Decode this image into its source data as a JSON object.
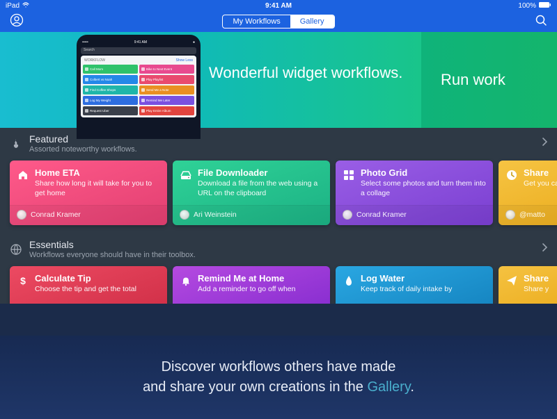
{
  "status": {
    "device": "iPad",
    "time": "9:41 AM",
    "battery": "100%"
  },
  "nav": {
    "tabs": {
      "my_workflows": "My Workflows",
      "gallery": "Gallery"
    }
  },
  "hero": {
    "widgets_title": "Wonderful widget workflows.",
    "run_title": "Run work",
    "phone": {
      "time": "9:41 AM",
      "search": "Search",
      "app": "WORKFLOW",
      "show_less": "Show Less",
      "tiles": [
        {
          "label": "Call Mom",
          "color": "#2fc26b"
        },
        {
          "label": "Bike to Next Event",
          "color": "#e84a8f"
        },
        {
          "label": "Colbert vs Noah",
          "color": "#2488e8"
        },
        {
          "label": "Play Playlist",
          "color": "#e94a6e"
        },
        {
          "label": "Find Coffee Shops",
          "color": "#1fb6a9"
        },
        {
          "label": "Send Me a Note",
          "color": "#e98f22"
        },
        {
          "label": "Log My Weight",
          "color": "#2d6de0"
        },
        {
          "label": "Remind Me Later",
          "color": "#7a50e0"
        },
        {
          "label": "Request Uber",
          "color": "#3a3f4a"
        },
        {
          "label": "Play Entire Album",
          "color": "#e2443e"
        }
      ]
    }
  },
  "featured": {
    "title": "Featured",
    "subtitle": "Assorted noteworthy workflows.",
    "cards": [
      {
        "title": "Home ETA",
        "desc": "Share how long it will take for you to get home",
        "author": "Conrad Kramer",
        "gradient": [
          "#ff5a8a",
          "#e23f71"
        ],
        "icon": "home"
      },
      {
        "title": "File Downloader",
        "desc": "Download a file from the web using a URL on the clipboard",
        "author": "Ari Weinstein",
        "gradient": [
          "#2fd297",
          "#1cb184"
        ],
        "icon": "hdd"
      },
      {
        "title": "Photo Grid",
        "desc": "Select some photos and turn them into a collage",
        "author": "Conrad Kramer",
        "gradient": [
          "#9a5ee6",
          "#7a3fd1"
        ],
        "icon": "grid"
      },
      {
        "title": "Share",
        "desc": "Get you calend",
        "author": "@matto",
        "gradient": [
          "#f6c443",
          "#e8a614"
        ],
        "icon": "clock"
      }
    ]
  },
  "essentials": {
    "title": "Essentials",
    "subtitle": "Workflows everyone should have in their toolbox.",
    "cards": [
      {
        "title": "Calculate Tip",
        "desc": "Choose the tip and get the total",
        "gradient": [
          "#ec4a62",
          "#d23149"
        ],
        "icon": "dollar"
      },
      {
        "title": "Remind Me at Home",
        "desc": "Add a reminder to go off when",
        "gradient": [
          "#b54ae0",
          "#8a2fd1"
        ],
        "icon": "bell"
      },
      {
        "title": "Log Water",
        "desc": "Keep track of daily intake by",
        "gradient": [
          "#2aa7e2",
          "#1686c2"
        ],
        "icon": "drop"
      },
      {
        "title": "Share",
        "desc": "Share y",
        "gradient": [
          "#f5c241",
          "#e8a614"
        ],
        "icon": "send"
      }
    ]
  },
  "promo": {
    "line1": "Discover workflows others have made",
    "line2_a": "and share your own creations in the ",
    "line2_b": "Gallery",
    "line2_c": "."
  }
}
